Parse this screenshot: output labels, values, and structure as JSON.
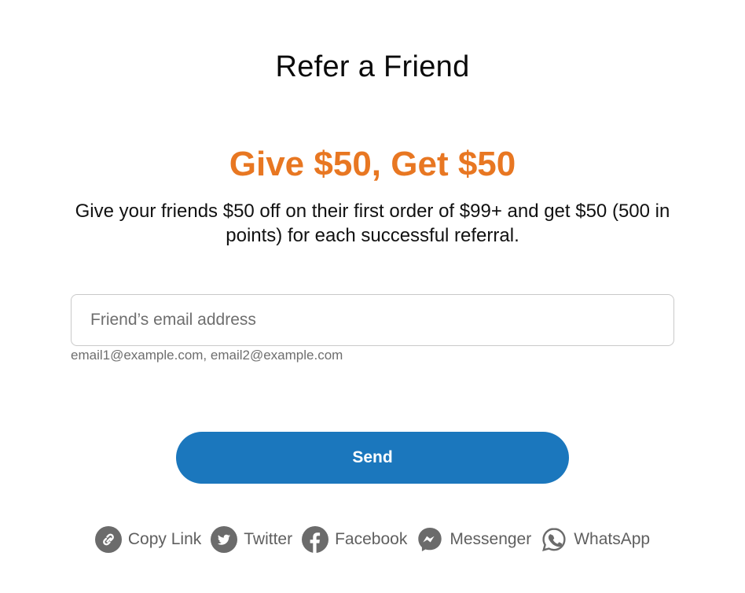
{
  "modal": {
    "title": "Refer a Friend",
    "headline": "Give $50, Get $50",
    "description": "Give your friends $50 off on their first order of $99+ and get $50 (500 in points) for each successful referral.",
    "email_input": {
      "placeholder": "Friend’s email address",
      "value": ""
    },
    "email_hint": "email1@example.com, email2@example.com",
    "send_label": "Send",
    "share": [
      {
        "label": "Copy Link",
        "icon": "link-icon"
      },
      {
        "label": "Twitter",
        "icon": "twitter-icon"
      },
      {
        "label": "Facebook",
        "icon": "facebook-icon"
      },
      {
        "label": "Messenger",
        "icon": "messenger-icon"
      },
      {
        "label": "WhatsApp",
        "icon": "whatsapp-icon"
      }
    ]
  },
  "colors": {
    "headline": "#e87722",
    "button": "#1b77bd",
    "icon": "#6b6b6b"
  }
}
